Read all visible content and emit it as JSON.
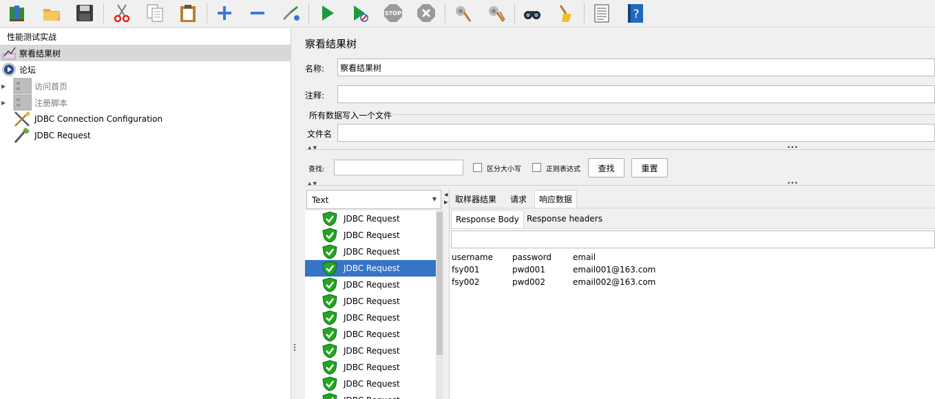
{
  "toolbar": {
    "buttons": [
      {
        "name": "templates-icon"
      },
      {
        "name": "open-icon"
      },
      {
        "name": "save-icon"
      },
      {
        "name": "cut-icon"
      },
      {
        "name": "copy-icon"
      },
      {
        "name": "paste-icon"
      },
      {
        "name": "expand-icon"
      },
      {
        "name": "collapse-icon"
      },
      {
        "name": "toggle-icon"
      },
      {
        "name": "start-icon"
      },
      {
        "name": "start-no-timers-icon"
      },
      {
        "name": "stop-icon",
        "label": "STOP"
      },
      {
        "name": "shutdown-icon"
      },
      {
        "name": "clear-icon"
      },
      {
        "name": "clear-all-icon"
      },
      {
        "name": "search-icon"
      },
      {
        "name": "reset-search-icon"
      },
      {
        "name": "function-helper-icon"
      },
      {
        "name": "help-icon",
        "label": "?"
      }
    ]
  },
  "tree": {
    "items": [
      {
        "label": "性能测试实战",
        "icon": "test-plan-icon"
      },
      {
        "label": "察看结果树",
        "icon": "listener-icon",
        "selected": true
      },
      {
        "label": "论坛",
        "icon": "thread-group-icon"
      },
      {
        "label": "访问首页",
        "icon": "controller-icon",
        "disabled": true,
        "expandable": true
      },
      {
        "label": "注册脚本",
        "icon": "controller-icon",
        "disabled": true,
        "expandable": true
      },
      {
        "label": "JDBC Connection Configuration",
        "icon": "config-icon"
      },
      {
        "label": "JDBC Request",
        "icon": "sampler-icon"
      }
    ]
  },
  "panel": {
    "title": "察看结果树",
    "name_label": "名称:",
    "name_value": "察看结果树",
    "comment_label": "注释:",
    "comment_value": "",
    "file_group_label": "所有数据写入一个文件",
    "filename_label": "文件名",
    "filename_value": ""
  },
  "search": {
    "label": "查找:",
    "value": "",
    "case_sensitive_label": "区分大小写",
    "regex_label": "正则表达式",
    "find_button": "查找",
    "reset_button": "重置"
  },
  "renderer": {
    "selected": "Text"
  },
  "results": {
    "items": [
      {
        "label": "JDBC Request",
        "status": "success"
      },
      {
        "label": "JDBC Request",
        "status": "success"
      },
      {
        "label": "JDBC Request",
        "status": "success"
      },
      {
        "label": "JDBC Request",
        "status": "success",
        "selected": true
      },
      {
        "label": "JDBC Request",
        "status": "success"
      },
      {
        "label": "JDBC Request",
        "status": "success"
      },
      {
        "label": "JDBC Request",
        "status": "success"
      },
      {
        "label": "JDBC Request",
        "status": "success"
      },
      {
        "label": "JDBC Request",
        "status": "success"
      },
      {
        "label": "JDBC Request",
        "status": "success"
      },
      {
        "label": "JDBC Request",
        "status": "success"
      },
      {
        "label": "JDBC Request",
        "status": "success"
      }
    ]
  },
  "tabs": {
    "main": [
      {
        "label": "取样器结果"
      },
      {
        "label": "请求"
      },
      {
        "label": "响应数据",
        "active": true
      }
    ],
    "sub": [
      {
        "label": "Response Body",
        "active": true
      },
      {
        "label": "Response headers"
      }
    ]
  },
  "response": {
    "search_value": "",
    "columns": [
      "username",
      "password",
      "email"
    ],
    "rows": [
      [
        "fsy001",
        "pwd001",
        "email001@163.com"
      ],
      [
        "fsy002",
        "pwd002",
        "email002@163.com"
      ]
    ]
  },
  "colors": {
    "selection_blue": "#3574c8",
    "success_green": "#23a623",
    "tree_selected": "#d8d8d8"
  }
}
